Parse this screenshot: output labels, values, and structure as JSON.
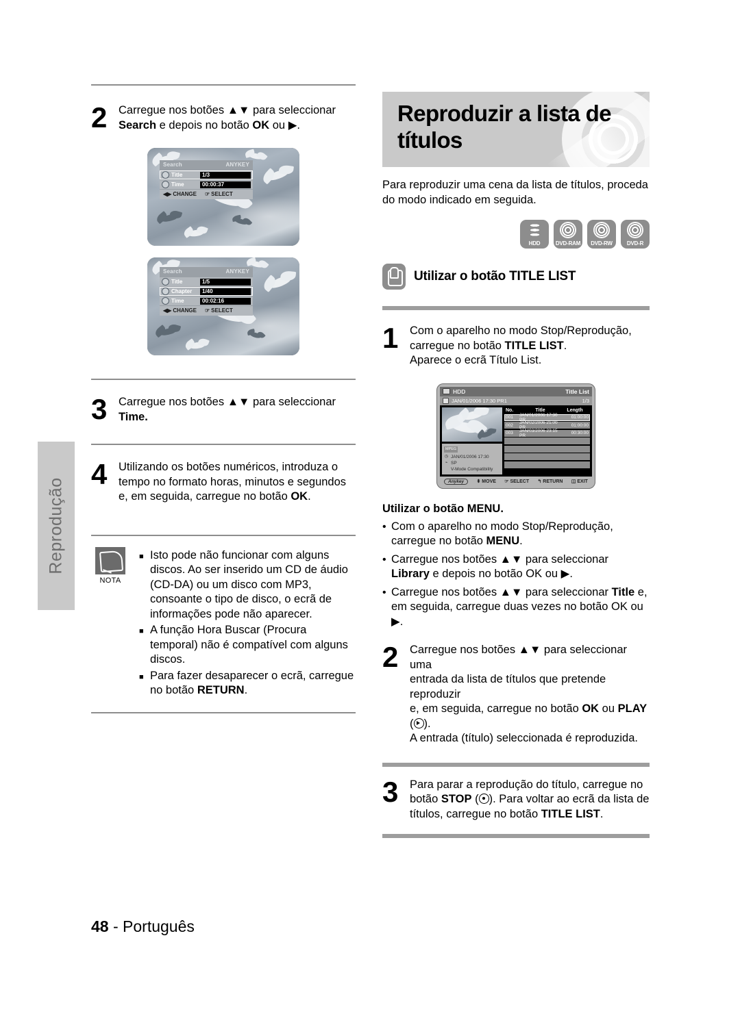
{
  "side_tab": {
    "label": "Reprodução"
  },
  "left_column": {
    "step2": {
      "number": "2",
      "line1_pre": "Carregue nos botões ",
      "arrows": "▲▼",
      "line1_post": " para seleccionar",
      "line2_bold": "Search",
      "line2_mid": " e depois no botão ",
      "line2_bold2": "OK",
      "line2_end": " ou ▶."
    },
    "osd1": {
      "header_left": "Search",
      "header_right": "ANYKEY",
      "rows": [
        {
          "label": "Title",
          "value": "1/3",
          "selected": true
        },
        {
          "label": "Time",
          "value": "00:00:37",
          "selected": false
        }
      ],
      "footer": [
        {
          "key": "◀▶",
          "label": "CHANGE"
        },
        {
          "key": "☞",
          "label": "SELECT"
        }
      ]
    },
    "osd2": {
      "header_left": "Search",
      "header_right": "ANYKEY",
      "rows": [
        {
          "label": "Title",
          "value": "1/5",
          "selected": false
        },
        {
          "label": "Chapter",
          "value": "1/40",
          "selected": true
        },
        {
          "label": "Time",
          "value": "00:02:16",
          "selected": false
        }
      ],
      "footer": [
        {
          "key": "◀▶",
          "label": "CHANGE"
        },
        {
          "key": "☞",
          "label": "SELECT"
        }
      ]
    },
    "step3": {
      "number": "3",
      "text_pre": "Carregue nos botões ",
      "arrows": "▲▼",
      "text_mid": " para seleccionar ",
      "text_bold": "Time."
    },
    "step4": {
      "number": "4",
      "text_pre": "Utilizando os botões numéricos, introduza o tempo no formato horas, minutos e segundos e, em seguida, carregue no botão ",
      "text_bold": "OK",
      "text_end": "."
    },
    "nota": {
      "label": "NOTA",
      "items": [
        {
          "pre": "Isto pode não funcionar com alguns discos. Ao ser inserido um CD de áudio (CD-DA) ou um disco com MP3, consoante o tipo de disco, o ecrã de informações pode não aparecer.",
          "bold": "",
          "post": ""
        },
        {
          "pre": "A função Hora Buscar (Procura temporal) não é compatível com alguns discos.",
          "bold": "",
          "post": ""
        },
        {
          "pre": "Para fazer desaparecer o ecrã, carregue no botão ",
          "bold": "RETURN",
          "post": "."
        }
      ]
    }
  },
  "right_column": {
    "header_title_line1": "Reproduzir a lista de",
    "header_title_line2": "títulos",
    "intro": "Para reproduzir uma cena da lista de títulos, proceda do modo indicado em seguida.",
    "media_badges": [
      {
        "name": "HDD",
        "icon": "hdd-icon"
      },
      {
        "name": "DVD-RAM",
        "icon": "disc-icon"
      },
      {
        "name": "DVD-RW",
        "icon": "disc-icon"
      },
      {
        "name": "DVD-R",
        "icon": "disc-icon"
      }
    ],
    "section_title": "Utilizar o botão TITLE LIST",
    "step1": {
      "number": "1",
      "line1": "Com o aparelho no modo Stop/Reprodução,",
      "line2_pre": "carregue no botão ",
      "line2_bold": "TITLE LIST",
      "line2_post": ".",
      "line3": "Aparece o ecrã Título List."
    },
    "title_list_screen": {
      "source_label": "HDD",
      "screen_label": "Title List",
      "current_item": "JAN/01/2006 17:30 PR1",
      "page_indicator": "1/3",
      "columns": [
        "No.",
        "Title",
        "Length"
      ],
      "rows": [
        {
          "no": "001",
          "title": "JAN/01/2006 17:30 PR",
          "length": "01:00:00",
          "selected": true
        },
        {
          "no": "002",
          "title": "JAN/02/2006 21:00 PR",
          "length": "01:00:00",
          "selected": false
        },
        {
          "no": "003",
          "title": "JAN/03/2006 23:15 PR",
          "length": "00:30:00",
          "selected": false
        }
      ],
      "empty_row_count": 4,
      "info_panel": {
        "format_badge": "MPEG",
        "datetime": "JAN/01/2006 17:30",
        "mode": "SP",
        "compatibility": "V-Mode Compatibility"
      },
      "footer": {
        "anykey": "Anykey",
        "actions": [
          {
            "key": "⬍",
            "label": "MOVE"
          },
          {
            "key": "☞",
            "label": "SELECT"
          },
          {
            "key": "↰",
            "label": "RETURN"
          },
          {
            "key": "◫",
            "label": "EXIT"
          }
        ]
      }
    },
    "menu_section": {
      "heading": "Utilizar o botão MENU.",
      "bullets": [
        {
          "pre": "Com o aparelho no modo Stop/Reprodução, carregue no botão ",
          "bold": "MENU",
          "post": "."
        },
        {
          "pre": "Carregue nos botões ▲▼ para seleccionar ",
          "bold": "Library",
          "post": " e depois no botão OK ou ▶."
        },
        {
          "pre": "Carregue nos botões ▲▼ para seleccionar ",
          "bold": "Title",
          "post": " e, em seguida, carregue duas vezes no botão OK ou ▶."
        }
      ]
    },
    "step2": {
      "number": "2",
      "line1": "Carregue nos botões ▲▼ para seleccionar uma",
      "line2": "entrada da lista de títulos que pretende reproduzir",
      "line3_pre": "e, em seguida, carregue no botão ",
      "line3_bold1": "OK",
      "line3_mid": " ou ",
      "line3_bold2": "PLAY",
      "line4": "A entrada (título) seleccionada é reproduzida."
    },
    "step3": {
      "number": "3",
      "line1_pre": "Para parar a reprodução do título, carregue no botão ",
      "line1_bold": "STOP",
      "line1_post": ". Para voltar ao ecrã da lista de títulos, carregue no botão ",
      "line1_bold2": "TITLE LIST",
      "line1_end": "."
    }
  },
  "footer": {
    "page_number": "48",
    "separator": " - ",
    "language": "Português"
  }
}
